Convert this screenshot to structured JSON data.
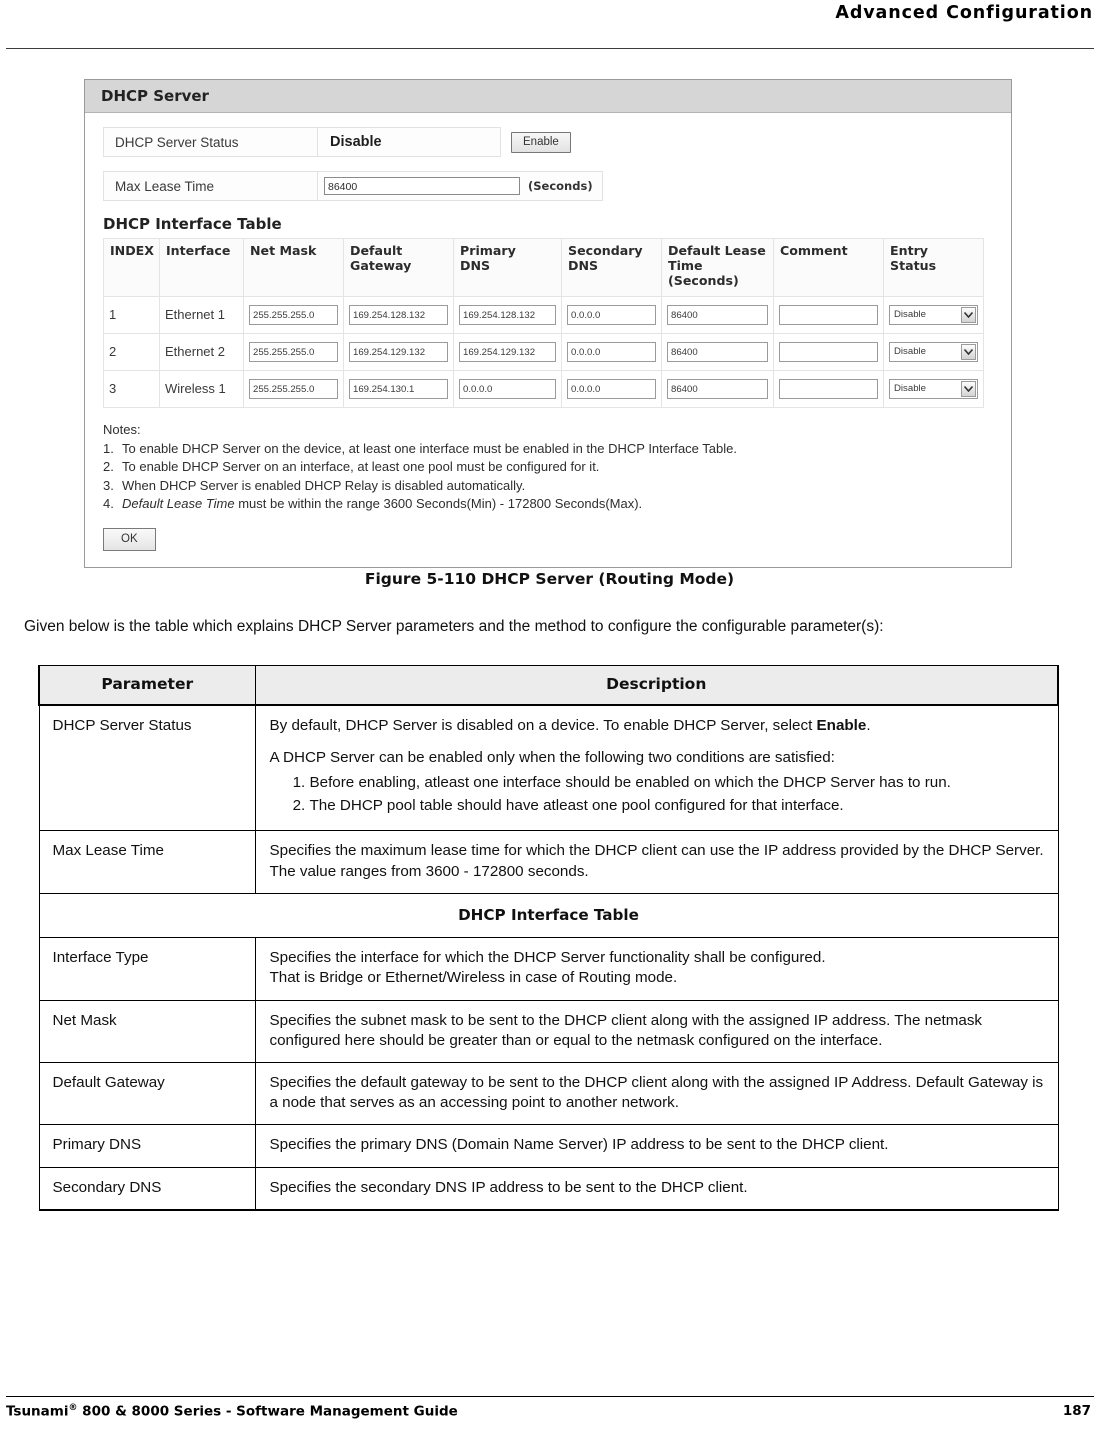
{
  "page": {
    "header_title": "Advanced Configuration",
    "footer_left_main": "Tsunami",
    "footer_left_sup": "®",
    "footer_left_rest": " 800 & 8000 Series - Software Management Guide",
    "footer_page_number": "187"
  },
  "screenshot": {
    "panel_title": "DHCP Server",
    "server_status": {
      "label": "DHCP Server Status",
      "value": "Disable",
      "button_label": "Enable"
    },
    "max_lease_time": {
      "label": "Max Lease Time",
      "value": "86400",
      "unit": "(Seconds)"
    },
    "interface_table": {
      "title": "DHCP Interface Table",
      "headers": [
        "INDEX",
        "Interface",
        "Net Mask",
        "Default\nGateway",
        "Primary\nDNS",
        "Secondary\nDNS",
        "Default Lease\nTime (Seconds)",
        "Comment",
        "Entry\nStatus"
      ],
      "headers_flat": [
        "INDEX",
        "Interface",
        "Net Mask",
        "Default Gateway",
        "Primary DNS",
        "Secondary DNS",
        "Default Lease Time (Seconds)",
        "Comment",
        "Entry Status"
      ],
      "rows": [
        {
          "index": "1",
          "interface": "Ethernet 1",
          "net_mask": "255.255.255.0",
          "default_gateway": "169.254.128.132",
          "primary_dns": "169.254.128.132",
          "secondary_dns": "0.0.0.0",
          "default_lease_time": "86400",
          "comment": "",
          "entry_status": "Disable"
        },
        {
          "index": "2",
          "interface": "Ethernet 2",
          "net_mask": "255.255.255.0",
          "default_gateway": "169.254.129.132",
          "primary_dns": "169.254.129.132",
          "secondary_dns": "0.0.0.0",
          "default_lease_time": "86400",
          "comment": "",
          "entry_status": "Disable"
        },
        {
          "index": "3",
          "interface": "Wireless 1",
          "net_mask": "255.255.255.0",
          "default_gateway": "169.254.130.1",
          "primary_dns": "0.0.0.0",
          "secondary_dns": "0.0.0.0",
          "default_lease_time": "86400",
          "comment": "",
          "entry_status": "Disable"
        }
      ]
    },
    "notes": {
      "heading": "Notes:",
      "items": [
        {
          "number": "1.",
          "text": "To enable DHCP Server on the device, at least one interface must be enabled in the DHCP Interface Table."
        },
        {
          "number": "2.",
          "text": "To enable DHCP Server on an interface, at least one pool must be configured for it."
        },
        {
          "number": "3.",
          "text": "When DHCP Server is enabled DHCP Relay is disabled automatically."
        },
        {
          "number": "4.",
          "italic_lead": "Default Lease Time",
          "text": " must be within the range 3600 Seconds(Min) - 172800 Seconds(Max)."
        }
      ]
    },
    "ok_button_label": "OK"
  },
  "figure": {
    "caption": "Figure 5-110 DHCP Server (Routing Mode)"
  },
  "intro_paragraph": "Given below is the table which explains DHCP Server parameters and the method to configure the configurable parameter(s):",
  "parameter_table": {
    "headers": [
      "Parameter",
      "Description"
    ],
    "section_heading": "DHCP Interface Table",
    "rows": {
      "dhcp_server_status": {
        "name": "DHCP Server Status",
        "desc_line1_pre": "By default, DHCP Server is disabled on a device. To enable DHCP Server, select ",
        "desc_line1_bold": "Enable",
        "desc_line1_post": ".",
        "desc_line2": "A DHCP Server can be enabled only when the following two conditions are satisfied:",
        "conditions": [
          "Before enabling, atleast one interface should be enabled on which the DHCP Server has to run.",
          "The DHCP pool table should have atleast one pool configured for that interface."
        ]
      },
      "max_lease_time": {
        "name": "Max Lease Time",
        "desc": "Specifies the maximum lease time for which the DHCP client can use the IP address provided by the DHCP Server. The value ranges from 3600 - 172800 seconds."
      },
      "interface_type": {
        "name": "Interface Type",
        "desc_line1": "Specifies the interface for which the DHCP Server functionality shall be configured.",
        "desc_line2": "That is Bridge or Ethernet/Wireless in case of Routing mode."
      },
      "net_mask": {
        "name": "Net Mask",
        "desc": "Specifies the subnet mask to be sent to the DHCP client along with the assigned IP address. The netmask configured here should be greater than or equal to the netmask configured on the interface."
      },
      "default_gateway": {
        "name": "Default Gateway",
        "desc": "Specifies the default gateway to be sent to the DHCP client along with the assigned IP Address. Default Gateway is a node that serves as an accessing point to another network."
      },
      "primary_dns": {
        "name": "Primary DNS",
        "desc": "Specifies the primary DNS (Domain Name Server) IP address to be sent to the DHCP client."
      },
      "secondary_dns": {
        "name": "Secondary DNS",
        "desc": "Specifies the secondary DNS IP address to be sent to the DHCP client."
      }
    }
  }
}
